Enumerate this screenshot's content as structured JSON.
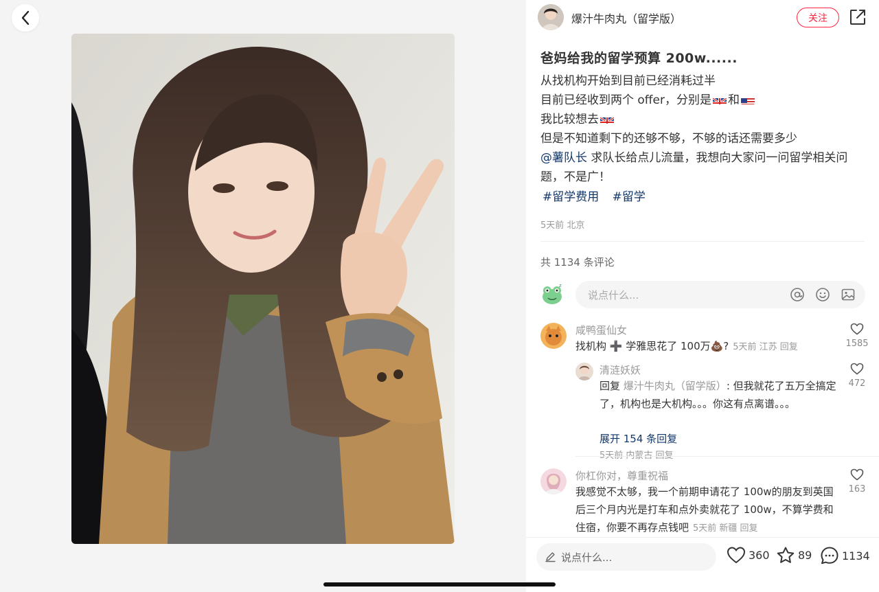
{
  "post": {
    "author": "爆汁牛肉丸（留学版）",
    "follow_label": "关注",
    "title": "爸妈给我的留学预算 200w......",
    "body_line1": "从找机构开始到目前已经消耗过半",
    "body_line2_a": "目前已经收到两个 offer，分别是",
    "body_line2_and": "和",
    "body_line3": "我比较想去",
    "body_line4": "但是不知道剩下的还够不够，不够的话还需要多少",
    "mention": "@薯队长",
    "body_line5_rest": " 求队长给点儿流量，我想向大家问一问留学相关问",
    "body_line6": "题，不是广！",
    "tags": [
      "#留学费用",
      "#留学"
    ],
    "meta": "5天前 北京",
    "comment_total": "共 1134 条评论"
  },
  "comment_input": {
    "placeholder": "说点什么..."
  },
  "comments": [
    {
      "name": "咸鸭蛋仙女",
      "text": "找机构 ➕ 学雅思花了 100万💩?",
      "meta": "5天前 江苏 回复",
      "likes": "1585"
    },
    {
      "name": "清涟妖妖",
      "reply_prefix": "回复",
      "reply_to": "爆汁牛肉丸（留学版）",
      "text_line1": ": 但我就花了五万全搞定",
      "text_line2": "了，机构也是大机构。。。你这有点离谱。。。",
      "meta": "5天前 内蒙古 回复",
      "likes": "472",
      "expand": "展开 154 条回复"
    },
    {
      "name": "你杠你对，尊重祝福",
      "text_line1": "我感觉不太够，我一个前期申请花了 100w的朋友到英国",
      "text_line2": "后三个月内光是打车和点外卖就花了 100w，不算学费和",
      "text_line3": "住宿，你要不再存点钱吧",
      "meta": "5天前 新疆 回复",
      "likes": "163"
    }
  ],
  "bottom_bar": {
    "placeholder": "说点什么...",
    "likes": "360",
    "stars": "89",
    "comments": "1134"
  },
  "colors": {
    "accent": "#ff2442",
    "link": "#13386c"
  },
  "icons": [
    "back-icon",
    "share-icon",
    "at-icon",
    "emoji-icon",
    "image-icon",
    "heart-icon",
    "star-icon",
    "comment-icon",
    "pencil-icon"
  ]
}
